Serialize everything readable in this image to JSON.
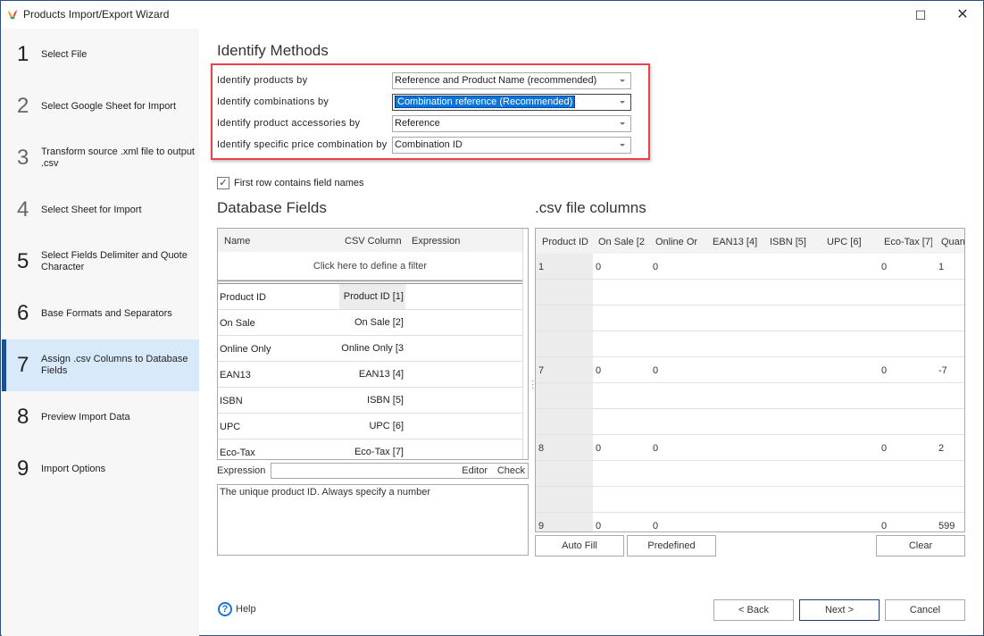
{
  "window": {
    "title": "Products Import/Export Wizard",
    "maximize_icon": "☐",
    "close_icon": "✕"
  },
  "sidebar": {
    "steps": [
      {
        "num": "1",
        "label": "Select File"
      },
      {
        "num": "2",
        "label": "Select Google Sheet for Import"
      },
      {
        "num": "3",
        "label": "Transform source .xml file to output .csv"
      },
      {
        "num": "4",
        "label": "Select Sheet for Import"
      },
      {
        "num": "5",
        "label": "Select Fields Delimiter and Quote Character"
      },
      {
        "num": "6",
        "label": "Base Formats and Separators"
      },
      {
        "num": "7",
        "label": "Assign .csv Columns to Database Fields",
        "active": true
      },
      {
        "num": "8",
        "label": "Preview Import Data"
      },
      {
        "num": "9",
        "label": "Import Options"
      }
    ],
    "accent_color": "#1e4f8f"
  },
  "identify": {
    "title": "Identify Methods",
    "rows": [
      {
        "label": "Identify products by",
        "value": "Reference and Product Name (recommended)"
      },
      {
        "label": "Identify combinations by",
        "value": "Combination reference (Recommended)",
        "focused": true
      },
      {
        "label": "Identify product accessories by",
        "value": "Reference"
      },
      {
        "label": "Identify specific price combination by",
        "value": "Combination ID"
      }
    ],
    "highlight_color": "#e8434a"
  },
  "first_row_checkbox": {
    "label": "First row contains field names",
    "checked": true,
    "check_glyph": "✓"
  },
  "db_fields": {
    "title": "Database Fields",
    "columns": [
      "Name",
      "CSV Column",
      "Expression"
    ],
    "filter_text": "Click here to define a filter",
    "rows": [
      {
        "name": "Product ID",
        "csv": "Product ID [1]",
        "selected": true
      },
      {
        "name": "On Sale",
        "csv": "On Sale [2]"
      },
      {
        "name": "Online Only",
        "csv": "Online Only [3"
      },
      {
        "name": "EAN13",
        "csv": "EAN13 [4]"
      },
      {
        "name": "ISBN",
        "csv": "ISBN [5]"
      },
      {
        "name": "UPC",
        "csv": "UPC [6]"
      },
      {
        "name": "Eco-Tax",
        "csv": "Eco-Tax [7]"
      }
    ],
    "expression_label": "Expression",
    "expression_value": "",
    "editor_link": "Editor",
    "check_link": "Check",
    "description": "The unique product ID. Always specify a number"
  },
  "csv_columns": {
    "title": ".csv file columns",
    "headers": [
      "Product ID",
      "On Sale [2",
      "Online Or",
      "EAN13 [4]",
      "ISBN [5]",
      "UPC [6]",
      "Eco-Tax [7]",
      "Quan"
    ],
    "rows": [
      [
        "1",
        "0",
        "0",
        "",
        "",
        "",
        "0",
        "1"
      ],
      [
        "",
        "",
        "",
        "",
        "",
        "",
        "",
        ""
      ],
      [
        "",
        "",
        "",
        "",
        "",
        "",
        "",
        ""
      ],
      [
        "",
        "",
        "",
        "",
        "",
        "",
        "",
        ""
      ],
      [
        "7",
        "0",
        "0",
        "",
        "",
        "",
        "0",
        "-7"
      ],
      [
        "",
        "",
        "",
        "",
        "",
        "",
        "",
        ""
      ],
      [
        "",
        "",
        "",
        "",
        "",
        "",
        "",
        ""
      ],
      [
        "8",
        "0",
        "0",
        "",
        "",
        "",
        "0",
        "2"
      ],
      [
        "",
        "",
        "",
        "",
        "",
        "",
        "",
        ""
      ],
      [
        "",
        "",
        "",
        "",
        "",
        "",
        "",
        ""
      ],
      [
        "9",
        "0",
        "0",
        "",
        "",
        "",
        "0",
        "599"
      ]
    ],
    "auto_fill_label": "Auto Fill",
    "predefined_label": "Predefined",
    "clear_label": "Clear"
  },
  "footer": {
    "help_label": "Help",
    "help_icon": "?",
    "back_label": "< Back",
    "next_label": "Next >",
    "cancel_label": "Cancel"
  }
}
